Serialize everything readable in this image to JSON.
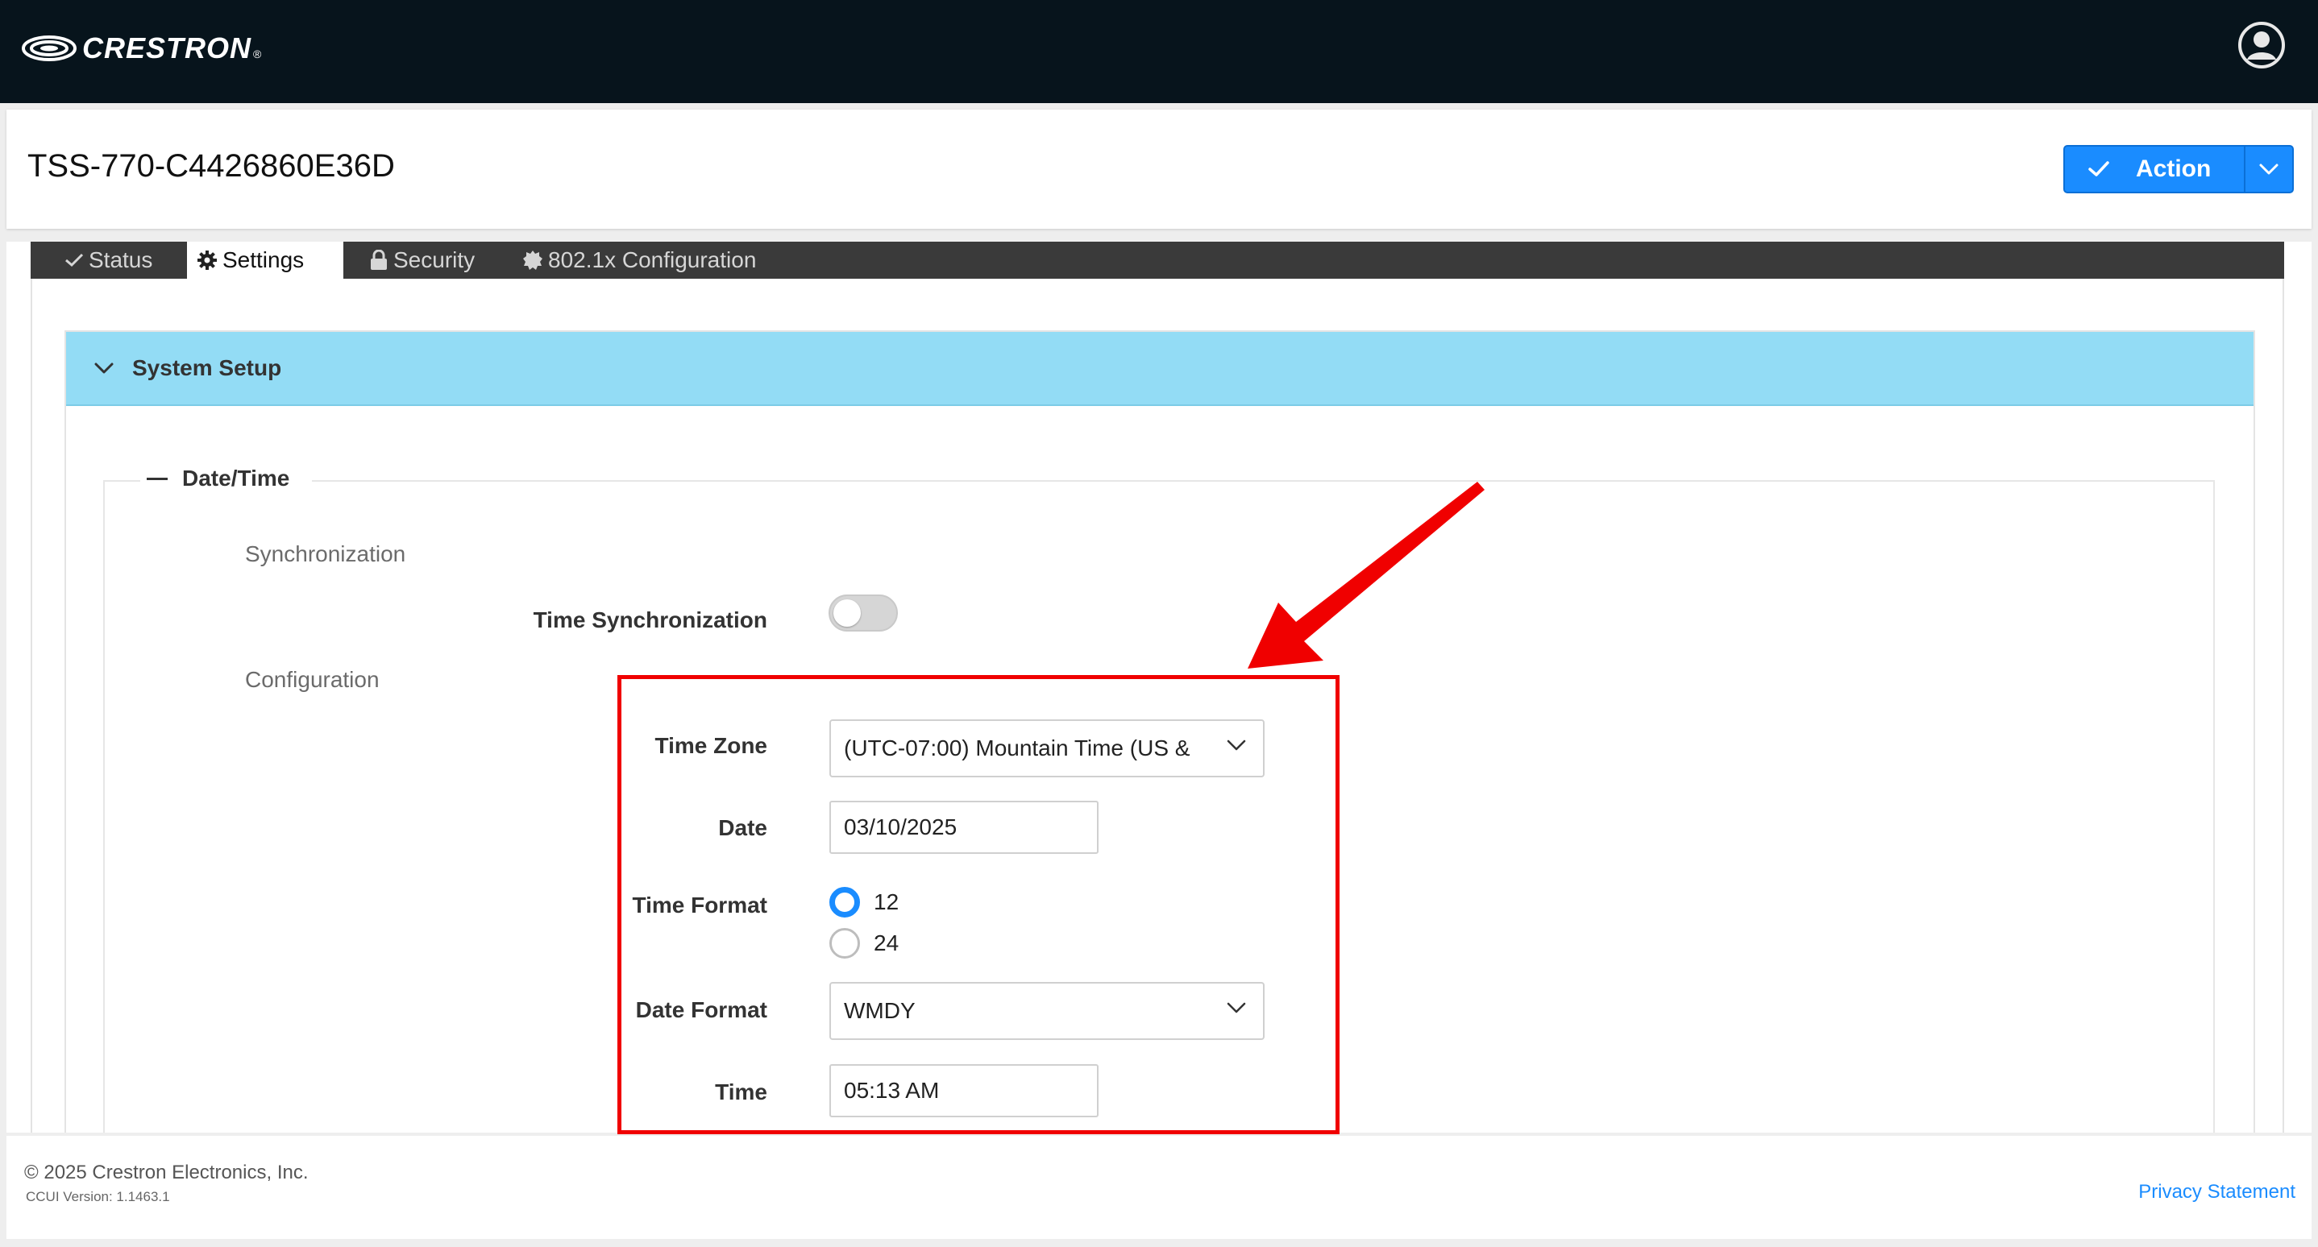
{
  "brand": {
    "wordmark": "CRESTRON",
    "reg": "®"
  },
  "header": {
    "device_name": "TSS-770-C4426860E36D",
    "action_label": "Action"
  },
  "tabs": [
    {
      "label": "Status",
      "icon": "check-icon"
    },
    {
      "label": "Settings",
      "icon": "gear-icon",
      "active": true
    },
    {
      "label": "Security",
      "icon": "lock-icon"
    },
    {
      "label": "802.1x Configuration",
      "icon": "badge-gear-icon"
    }
  ],
  "panel": {
    "title": "System Setup"
  },
  "fieldset": {
    "legend": "Date/Time"
  },
  "sync": {
    "section_label": "Synchronization",
    "time_sync_label": "Time Synchronization",
    "time_sync_enabled": false
  },
  "config": {
    "section_label": "Configuration",
    "time_zone_label": "Time Zone",
    "time_zone_value": "(UTC-07:00) Mountain Time (US &",
    "date_label": "Date",
    "date_value": "03/10/2025",
    "time_format_label": "Time Format",
    "time_format_options": [
      "12",
      "24"
    ],
    "time_format_selected": "12",
    "date_format_label": "Date Format",
    "date_format_value": "WMDY",
    "time_label": "Time",
    "time_value": "05:13 AM"
  },
  "footer": {
    "copyright": "© 2025 Crestron Electronics, Inc.",
    "version": "CCUI Version: 1.1463.1",
    "privacy": "Privacy Statement"
  },
  "colors": {
    "topbar": "#07141c",
    "accent": "#1a8cff",
    "panel_header": "#93dcf5",
    "highlight": "#f00000"
  }
}
